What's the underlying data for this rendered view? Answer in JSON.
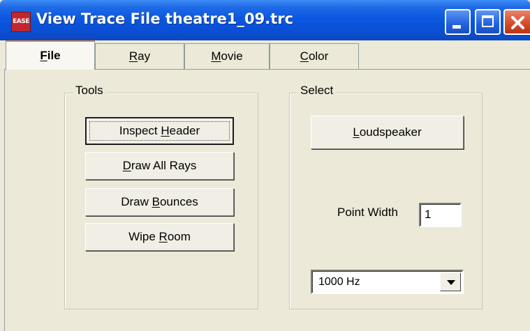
{
  "window": {
    "title": "View Trace File theatre1_09.trc",
    "app_icon_text": "EASE",
    "colors": {
      "titlebar": "#0b58e0",
      "face": "#ece9d8",
      "close": "#d24a2a"
    }
  },
  "tabs": [
    {
      "mnemonic": "F",
      "rest": "ile",
      "active": true
    },
    {
      "mnemonic": "R",
      "rest": "ay",
      "active": false
    },
    {
      "mnemonic": "M",
      "rest": "ovie",
      "active": false
    },
    {
      "mnemonic": "C",
      "rest": "olor",
      "active": false
    }
  ],
  "tools": {
    "legend": "Tools",
    "inspect_header": {
      "pre": "Inspect ",
      "mn": "H",
      "post": "eader"
    },
    "draw_all_rays": {
      "pre": "",
      "mn": "D",
      "post": "raw All Rays"
    },
    "draw_bounces": {
      "pre": "Draw ",
      "mn": "B",
      "post": "ounces"
    },
    "wipe_room": {
      "pre": "Wipe ",
      "mn": "R",
      "post": "oom"
    }
  },
  "select": {
    "legend": "Select",
    "loudspeaker": {
      "pre": "",
      "mn": "L",
      "post": "oudspeaker"
    },
    "point_width_label": "Point Width",
    "point_width_value": "1",
    "frequency_value": "1000 Hz"
  },
  "icons": [
    "app-icon",
    "minimize-icon",
    "maximize-icon",
    "close-icon",
    "chevron-down-icon"
  ]
}
